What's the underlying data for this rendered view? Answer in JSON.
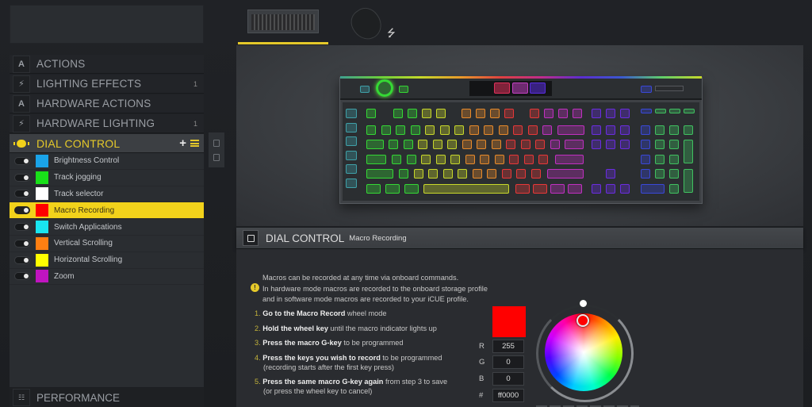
{
  "sidebar": {
    "menu": [
      {
        "icon": "A",
        "label": "ACTIONS",
        "count": ""
      },
      {
        "icon": "⚡",
        "label": "LIGHTING EFFECTS",
        "count": "1"
      },
      {
        "icon": "A",
        "label": "HARDWARE ACTIONS",
        "count": ""
      },
      {
        "icon": "⚡",
        "label": "HARDWARE LIGHTING",
        "count": "1"
      },
      {
        "icon": "dial",
        "label": "DIAL CONTROL",
        "count": ""
      }
    ],
    "add_label": "+",
    "dial_modes": [
      {
        "label": "Brightness Control",
        "color": "#1aa3e8",
        "enabled": true
      },
      {
        "label": "Track jogging",
        "color": "#19e019",
        "enabled": true
      },
      {
        "label": "Track selector",
        "color": "#ffffff",
        "enabled": true
      },
      {
        "label": "Macro Recording",
        "color": "#ff0000",
        "enabled": true,
        "selected": true
      },
      {
        "label": "Switch Applications",
        "color": "#19e5f0",
        "enabled": true
      },
      {
        "label": "Vertical Scrolling",
        "color": "#ff7f12",
        "enabled": true
      },
      {
        "label": "Horizontal Scrolling",
        "color": "#ffff00",
        "enabled": true
      },
      {
        "label": "Zoom",
        "color": "#c014c0",
        "enabled": true
      }
    ],
    "performance_label": "PERFORMANCE"
  },
  "device_tabs": [
    {
      "name": "keyboard",
      "active": true
    },
    {
      "name": "mouse",
      "active": false
    }
  ],
  "detail": {
    "title": "DIAL CONTROL",
    "subtitle": "Macro Recording",
    "info_lines": [
      "Macros can be recorded at any time via onboard commands.",
      "In hardware mode macros are recorded to the onboard storage profile",
      "and in software mode macros are recorded to your iCUE profile."
    ],
    "steps": [
      {
        "num": "1.",
        "strong": "Go to the Macro Record",
        "rest": " wheel mode",
        "sub": ""
      },
      {
        "num": "2.",
        "strong": "Hold the wheel key",
        "rest": " until the macro indicator lights up",
        "sub": ""
      },
      {
        "num": "3.",
        "strong": "Press the macro G-key",
        "rest": " to be programmed",
        "sub": ""
      },
      {
        "num": "4.",
        "strong": "Press the keys you wish to record",
        "rest": " to be programmed",
        "sub": "(recording starts after the first key press)"
      },
      {
        "num": "5.",
        "strong": "Press the same macro G-key again",
        "rest": " from step 3 to save",
        "sub": "(or press the wheel key to cancel)"
      }
    ],
    "color": {
      "preview": "#ff0000",
      "r_label": "R",
      "r": "255",
      "g_label": "G",
      "g": "0",
      "b_label": "B",
      "b": "0",
      "hex_label": "#",
      "hex": "ff0000"
    }
  }
}
